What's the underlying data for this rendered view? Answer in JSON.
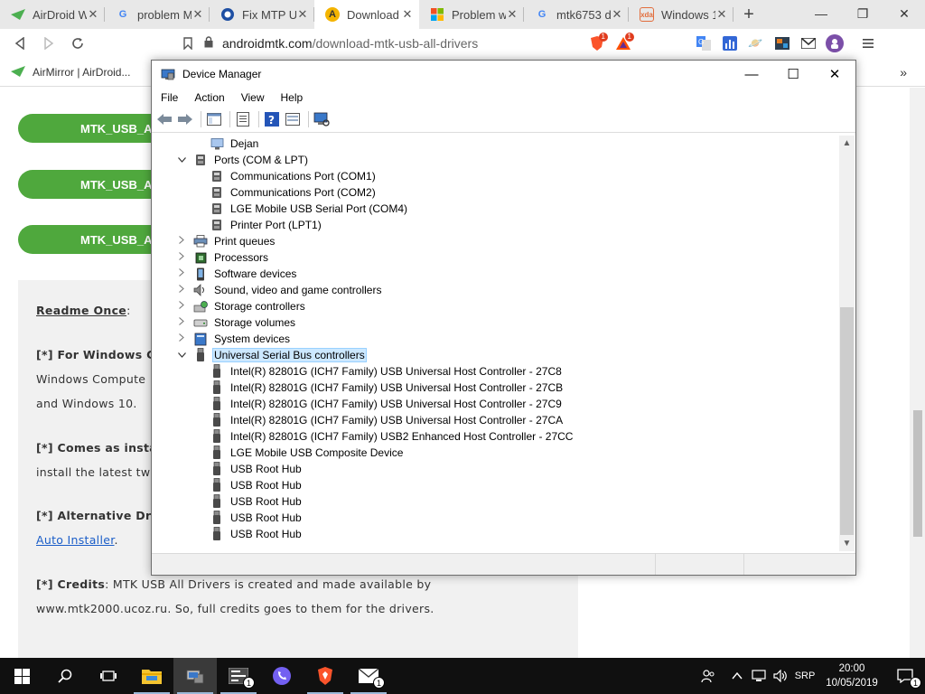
{
  "browser": {
    "tabs": [
      {
        "title": "AirDroid W",
        "icon": "airdroid-icon",
        "active": false
      },
      {
        "title": "problem M",
        "icon": "google-icon",
        "active": false
      },
      {
        "title": "Fix MTP US",
        "icon": "site-icon",
        "active": false
      },
      {
        "title": "Download",
        "icon": "androidmtk-icon",
        "active": true
      },
      {
        "title": "Problem w",
        "icon": "microsoft-icon",
        "active": false
      },
      {
        "title": "mtk6753 d",
        "icon": "google-icon",
        "active": false
      },
      {
        "title": "Windows 1",
        "icon": "xda-icon",
        "active": false
      }
    ],
    "url": {
      "host": "androidmtk.com",
      "path": "/download-mtk-usb-all-drivers"
    },
    "extension_badges": {
      "brave": "1",
      "bat": "1"
    },
    "bookmark": "AirMirror | AirDroid...",
    "overflow": "»"
  },
  "page": {
    "download_buttons": [
      "MTK_USB_A",
      "MTK_USB_A",
      "MTK_USB_A"
    ],
    "readme": {
      "heading": "Readme Once",
      "heading_suffix": ":",
      "p1_bold": "[*] For Windows Co",
      "p1_line2": "Windows Compute",
      "p1_line3": "and Windows 10.",
      "p2_bold": "[*] Comes as insta",
      "p2_line2": "install the latest tw",
      "p3_bold": "[*] Alternative Driv",
      "p3_link": "Auto Installer",
      "p3_period": ".",
      "p4_bold": "[*] Credits",
      "p4_rest": ": MTK USB All Drivers is created and made available by",
      "p4_line2": "www.mtk2000.ucoz.ru. So, full credits goes to them for the drivers."
    }
  },
  "device_manager": {
    "title": "Device Manager",
    "menu": [
      "File",
      "Action",
      "View",
      "Help"
    ],
    "tree": [
      {
        "label": "Dejan",
        "level": 1,
        "expander": "",
        "icon": "computer-icon"
      },
      {
        "label": "Ports (COM & LPT)",
        "level": 0,
        "expander": "expanded",
        "icon": "port-icon"
      },
      {
        "label": "Communications Port (COM1)",
        "level": 1,
        "expander": "",
        "icon": "port-icon"
      },
      {
        "label": "Communications Port (COM2)",
        "level": 1,
        "expander": "",
        "icon": "port-icon"
      },
      {
        "label": "LGE Mobile USB Serial Port (COM4)",
        "level": 1,
        "expander": "",
        "icon": "port-icon"
      },
      {
        "label": "Printer Port (LPT1)",
        "level": 1,
        "expander": "",
        "icon": "port-icon"
      },
      {
        "label": "Print queues",
        "level": 0,
        "expander": "collapsed",
        "icon": "printer-icon"
      },
      {
        "label": "Processors",
        "level": 0,
        "expander": "collapsed",
        "icon": "processor-icon"
      },
      {
        "label": "Software devices",
        "level": 0,
        "expander": "collapsed",
        "icon": "software-device-icon"
      },
      {
        "label": "Sound, video and game controllers",
        "level": 0,
        "expander": "collapsed",
        "icon": "speaker-icon"
      },
      {
        "label": "Storage controllers",
        "level": 0,
        "expander": "collapsed",
        "icon": "storage-controller-icon"
      },
      {
        "label": "Storage volumes",
        "level": 0,
        "expander": "collapsed",
        "icon": "storage-volume-icon"
      },
      {
        "label": "System devices",
        "level": 0,
        "expander": "collapsed",
        "icon": "system-device-icon"
      },
      {
        "label": "Universal Serial Bus controllers",
        "level": 0,
        "expander": "expanded",
        "icon": "usb-icon",
        "selected": true
      },
      {
        "label": "Intel(R) 82801G (ICH7 Family) USB Universal Host Controller - 27C8",
        "level": 1,
        "expander": "",
        "icon": "usb-icon"
      },
      {
        "label": "Intel(R) 82801G (ICH7 Family) USB Universal Host Controller - 27CB",
        "level": 1,
        "expander": "",
        "icon": "usb-icon"
      },
      {
        "label": "Intel(R) 82801G (ICH7 Family) USB Universal Host Controller - 27C9",
        "level": 1,
        "expander": "",
        "icon": "usb-icon"
      },
      {
        "label": "Intel(R) 82801G (ICH7 Family) USB Universal Host Controller - 27CA",
        "level": 1,
        "expander": "",
        "icon": "usb-icon"
      },
      {
        "label": "Intel(R) 82801G (ICH7 Family) USB2 Enhanced Host Controller - 27CC",
        "level": 1,
        "expander": "",
        "icon": "usb-icon"
      },
      {
        "label": "LGE Mobile USB Composite Device",
        "level": 1,
        "expander": "",
        "icon": "usb-icon"
      },
      {
        "label": "USB Root Hub",
        "level": 1,
        "expander": "",
        "icon": "usb-icon"
      },
      {
        "label": "USB Root Hub",
        "level": 1,
        "expander": "",
        "icon": "usb-icon"
      },
      {
        "label": "USB Root Hub",
        "level": 1,
        "expander": "",
        "icon": "usb-icon"
      },
      {
        "label": "USB Root Hub",
        "level": 1,
        "expander": "",
        "icon": "usb-icon"
      },
      {
        "label": "USB Root Hub",
        "level": 1,
        "expander": "",
        "icon": "usb-icon"
      }
    ]
  },
  "taskbar": {
    "badges": {
      "app1": "1",
      "mail": "1",
      "notifications": "1"
    },
    "language": "SRP",
    "time": "20:00",
    "date": "10/05/2019"
  }
}
